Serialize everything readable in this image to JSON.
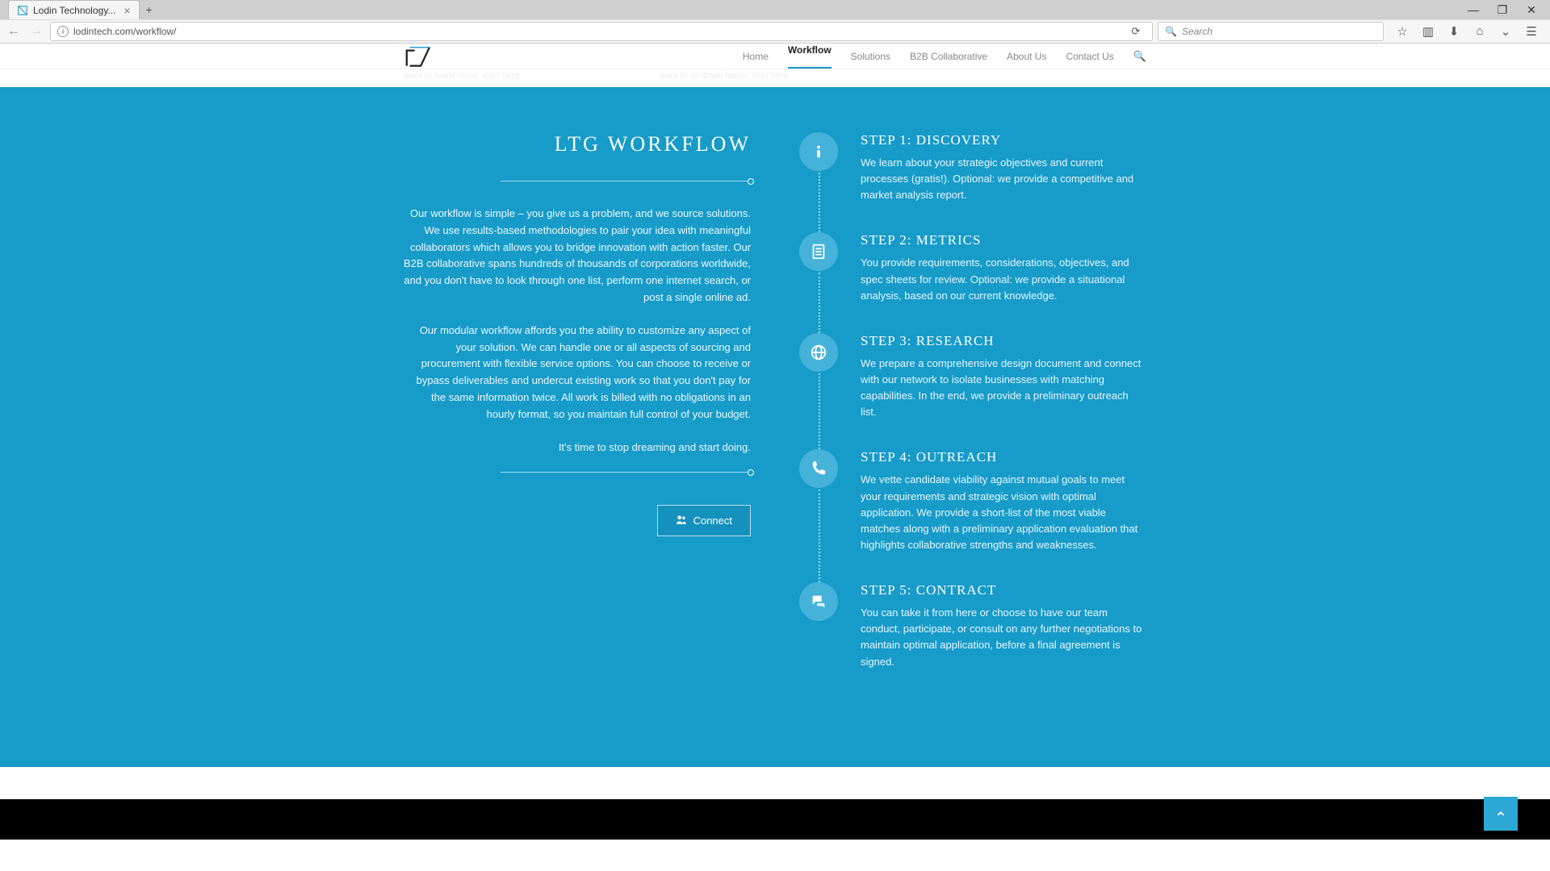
{
  "browser": {
    "tab_title": "Lodin Technology...",
    "url": "lodintech.com/workflow/",
    "search_placeholder": "Search"
  },
  "nav": {
    "items": [
      "Home",
      "Workflow",
      "Solutions",
      "B2B Collaborative",
      "About Us",
      "Contact Us"
    ],
    "active_index": 1
  },
  "remnant": {
    "left": "want to learn more, start here.",
    "right": "want to sit down faster, start here."
  },
  "left": {
    "title": "LTG WORKFLOW",
    "p1": "Our workflow is simple – you give us a problem, and we source solutions. We use results-based methodologies to pair your idea with meaningful collaborators which allows you to bridge innovation with action faster. Our B2B collaborative spans hundreds of thousands of corporations worldwide, and you don't have to look through one list, perform one internet search, or post a single online ad.",
    "p2": "Our modular workflow affords you the ability to customize any aspect of your solution. We can handle one or all aspects of sourcing and procurement with flexible service options. You can choose to receive or bypass deliverables and undercut existing work so that you don't pay for the same information twice. All work is billed with no obligations in an hourly format, so you maintain full control of your budget.",
    "p3": "It's time to stop dreaming and start doing.",
    "connect": "Connect"
  },
  "steps": [
    {
      "title": "STEP 1: DISCOVERY",
      "text": "We learn about your strategic objectives and current processes (gratis!). Optional: we provide a competitive and market analysis report."
    },
    {
      "title": "STEP 2: METRICS",
      "text": "You provide requirements, considerations, objectives, and spec sheets for review. Optional: we provide a situational analysis, based on our current knowledge."
    },
    {
      "title": "STEP 3: RESEARCH",
      "text": "We prepare a comprehensive design document and connect with our network to isolate businesses with matching capabilities. In the end, we provide a preliminary outreach list."
    },
    {
      "title": "STEP 4: OUTREACH",
      "text": "We vette candidate viability against mutual goals to meet your requirements and strategic vision with optimal application. We provide a short-list of the most viable matches along with a preliminary application evaluation that highlights collaborative strengths and weaknesses."
    },
    {
      "title": "STEP 5: CONTRACT",
      "text": "You can take it from here or choose to have our team conduct, participate, or consult on any further negotiations to maintain optimal application, before a final agreement is signed."
    }
  ]
}
